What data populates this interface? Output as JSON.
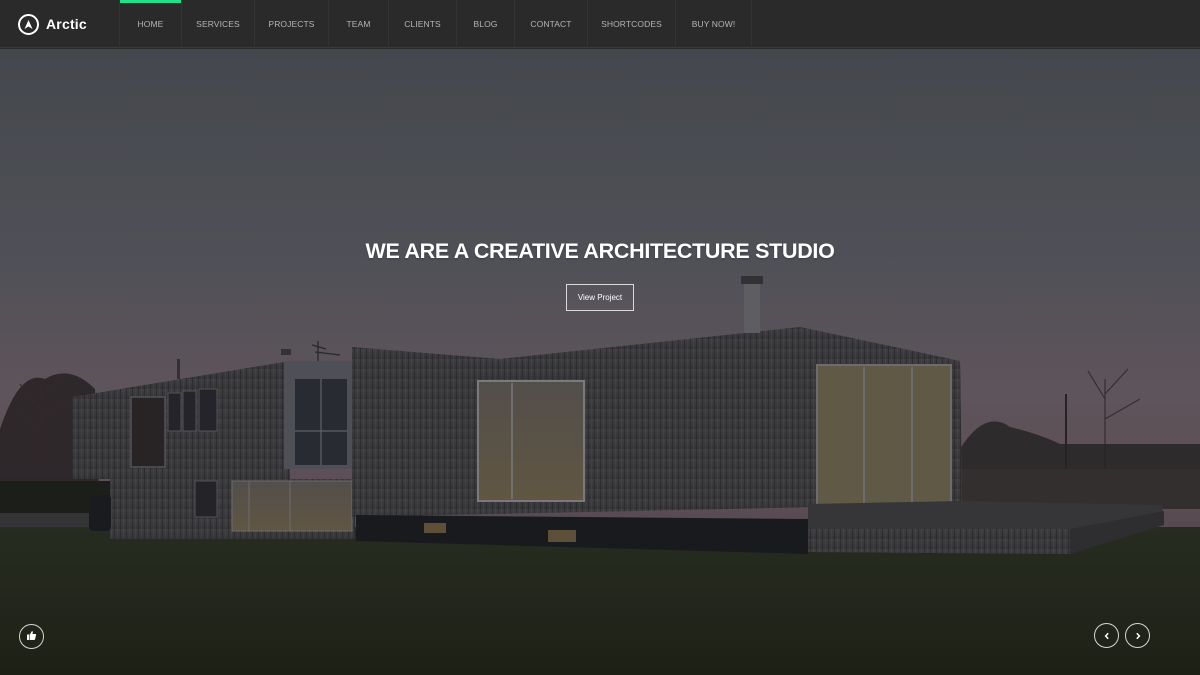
{
  "brand": {
    "name": "Arctic",
    "logo_icon": "a-circle-logo-icon"
  },
  "nav": {
    "items": [
      {
        "label": "Home",
        "active": true
      },
      {
        "label": "Services",
        "active": false
      },
      {
        "label": "Projects",
        "active": false
      },
      {
        "label": "Team",
        "active": false
      },
      {
        "label": "Clients",
        "active": false
      },
      {
        "label": "Blog",
        "active": false
      },
      {
        "label": "Contact",
        "active": false
      },
      {
        "label": "Shortcodes",
        "active": false
      },
      {
        "label": "Buy Now!",
        "active": false
      }
    ]
  },
  "hero": {
    "headline": "WE ARE A CREATIVE ARCHITECTURE STUDIO",
    "cta_label": "View Project",
    "background": "dusk photo of modern timber-clad house on lawn",
    "like_icon": "thumbs-up-icon",
    "prev_icon": "chevron-left-icon",
    "next_icon": "chevron-right-icon"
  },
  "colors": {
    "accent": "#1de28a",
    "navbar_bg": "#2a2a2a",
    "nav_text": "#b5b5b5",
    "text_light": "#ffffff"
  }
}
